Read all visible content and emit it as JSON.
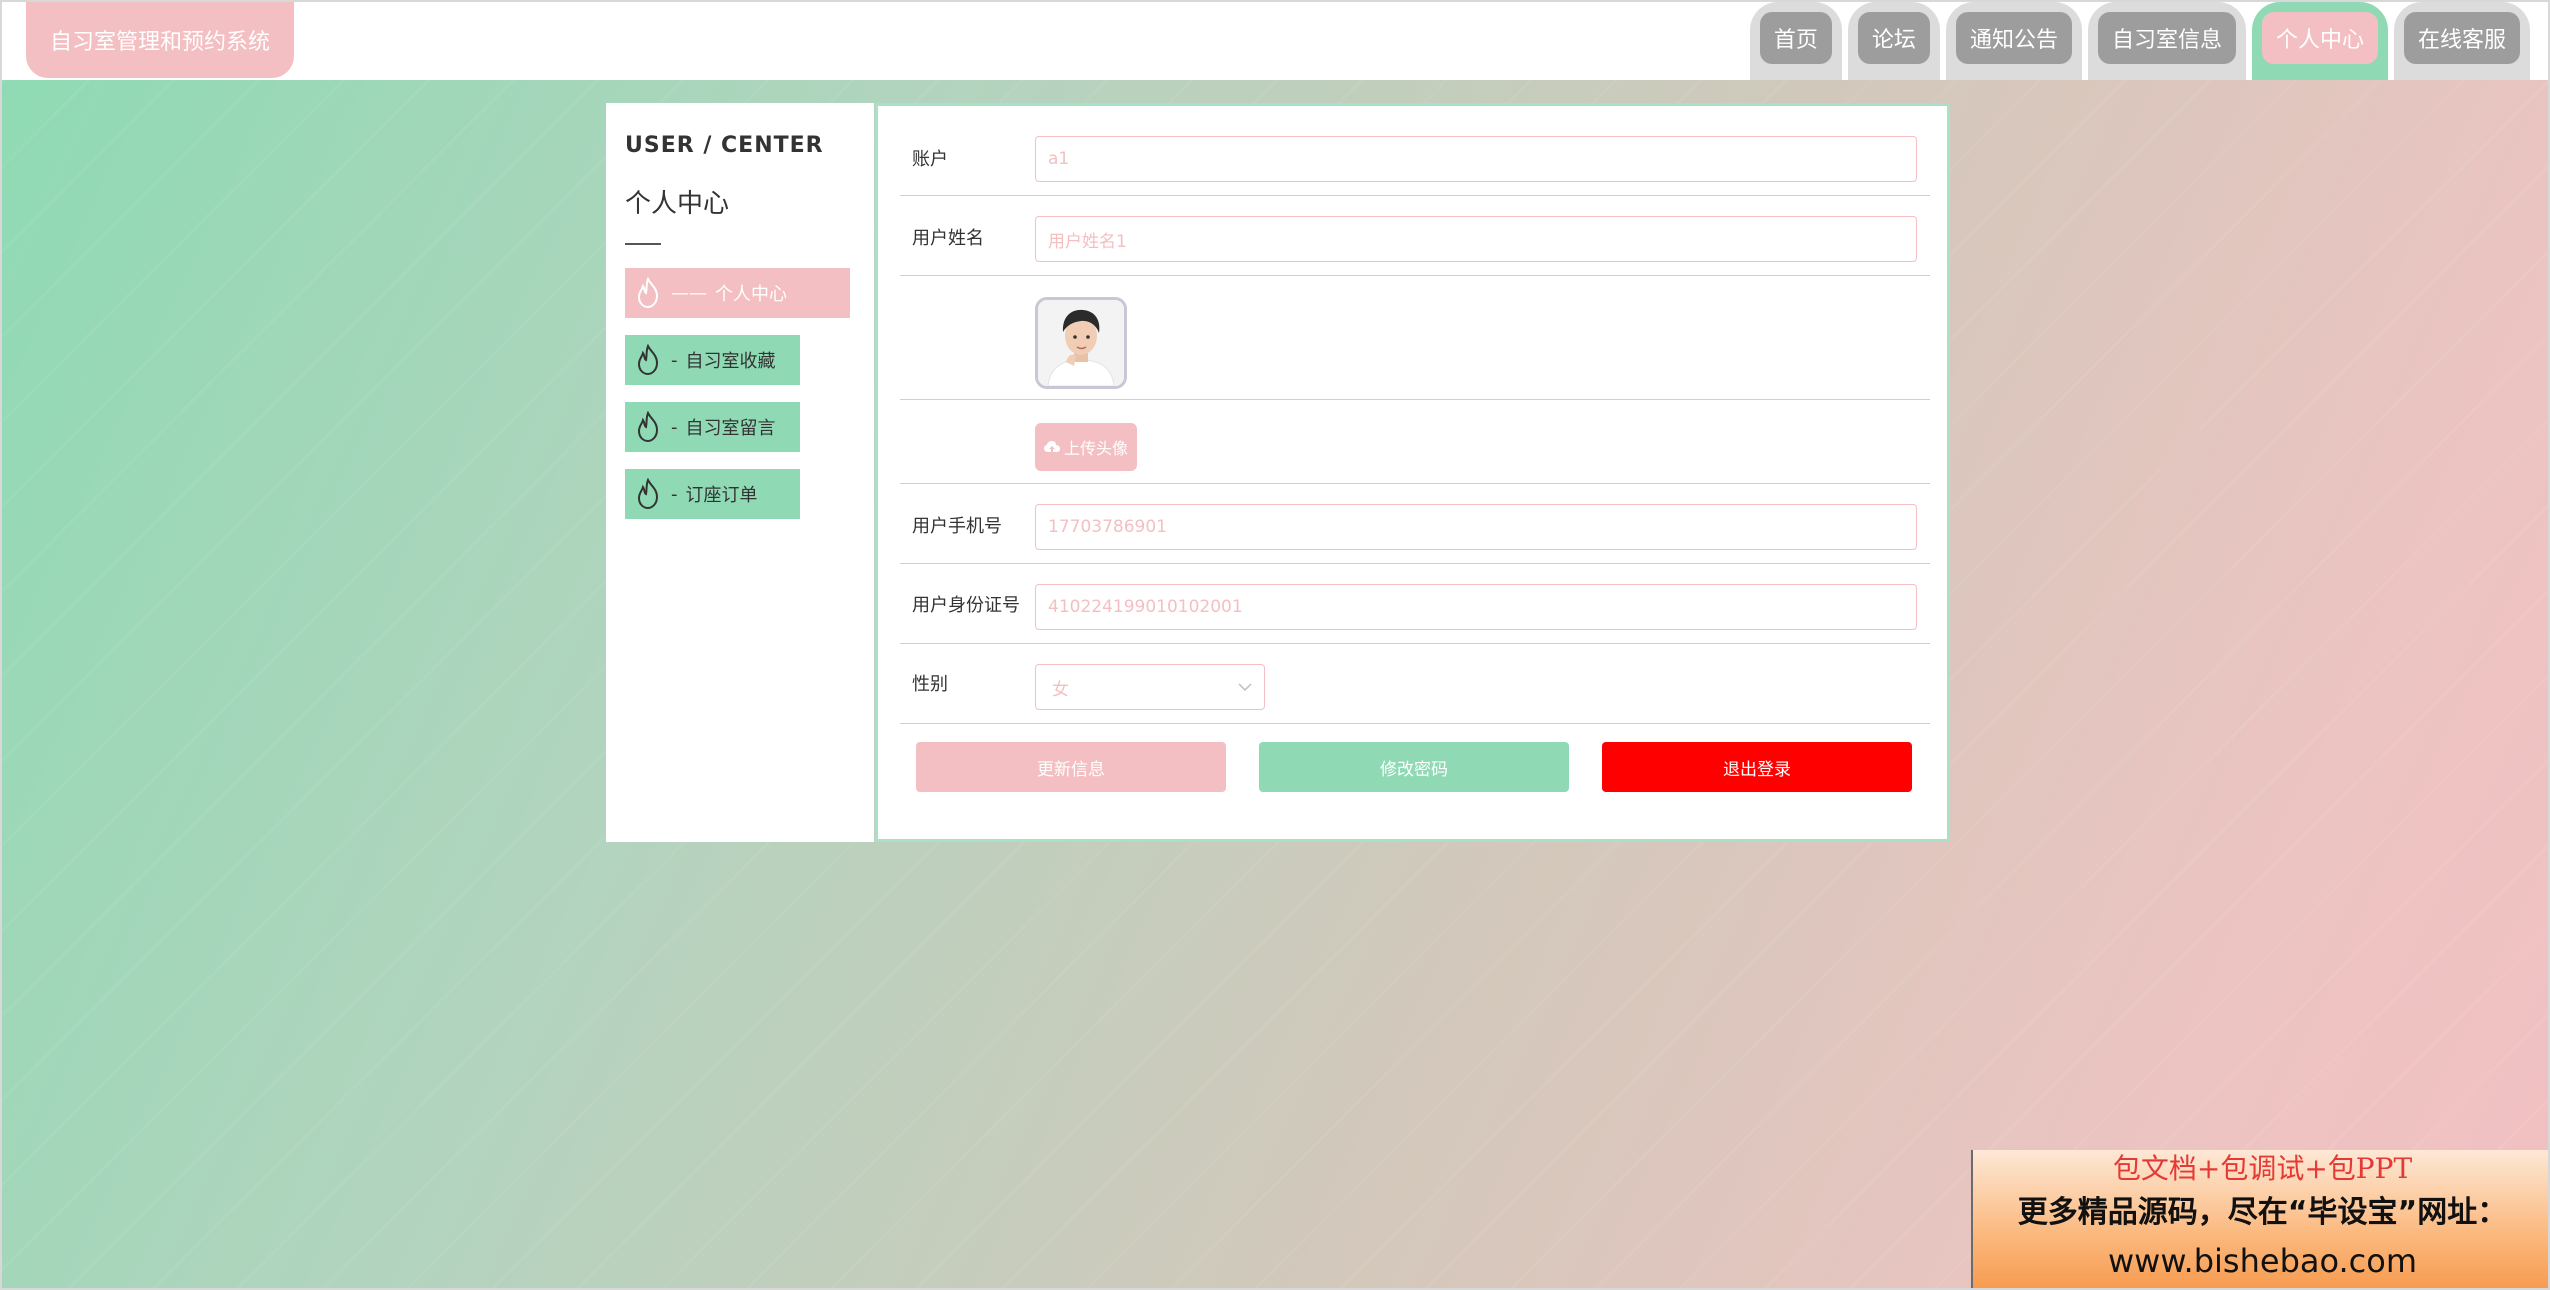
{
  "header": {
    "brand": "自习室管理和预约系统",
    "nav": [
      {
        "label": "首页",
        "active": false
      },
      {
        "label": "论坛",
        "active": false
      },
      {
        "label": "通知公告",
        "active": false
      },
      {
        "label": "自习室信息",
        "active": false
      },
      {
        "label": "个人中心",
        "active": true
      },
      {
        "label": "在线客服",
        "active": false
      }
    ]
  },
  "sidebar": {
    "title_en": "USER / CENTER",
    "title_cn": "个人中心",
    "items": [
      {
        "dash": "—— ",
        "label": "个人中心",
        "active": true
      },
      {
        "dash": "- ",
        "label": "自习室收藏",
        "active": false
      },
      {
        "dash": "- ",
        "label": "自习室留言",
        "active": false
      },
      {
        "dash": "- ",
        "label": "订座订单",
        "active": false
      }
    ]
  },
  "form": {
    "account_label": "账户",
    "account_value": "a1",
    "name_label": "用户姓名",
    "name_value": "用户姓名1",
    "upload_label": "上传头像",
    "phone_label": "用户手机号",
    "phone_value": "17703786901",
    "idcard_label": "用户身份证号",
    "idcard_value": "410224199010102001",
    "gender_label": "性别",
    "gender_value": "女",
    "update_button": "更新信息",
    "password_button": "修改密码",
    "logout_button": "退出登录"
  },
  "ad": {
    "line1": "包文档+包调试+包PPT",
    "line2": "更多精品源码，尽在“毕设宝”网址：",
    "line3": "www.bishebao.com"
  },
  "colors": {
    "pink": "#f4bfc2",
    "green": "#8fdab4",
    "red": "#ff0000",
    "gray_nav": "#9d9d9d"
  }
}
